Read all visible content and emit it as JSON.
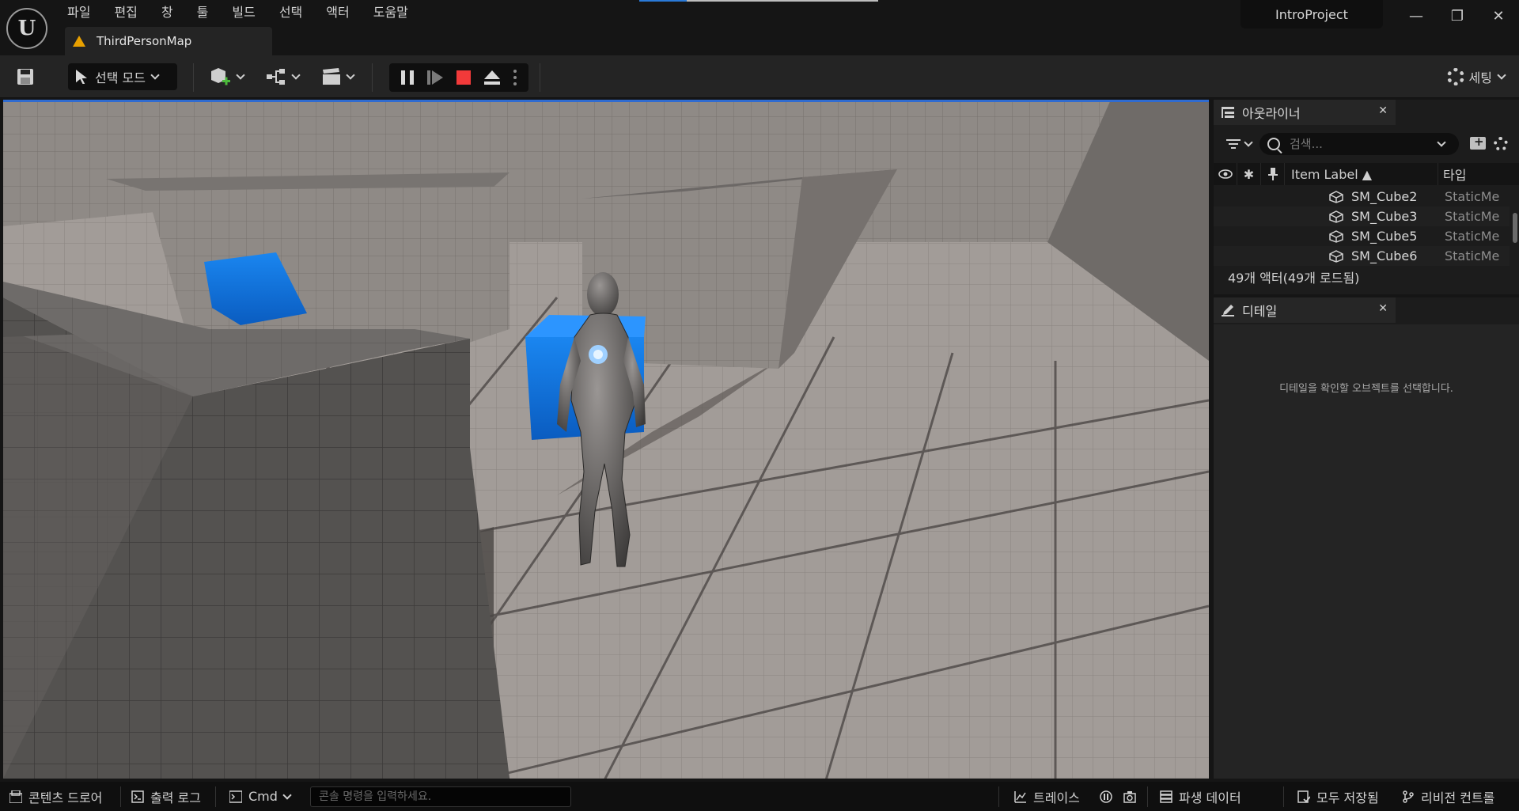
{
  "window": {
    "map_tab": "ThirdPersonMap",
    "project": "IntroProject",
    "minimize": "—",
    "restore": "❐",
    "close": "✕"
  },
  "menu": [
    "파일",
    "편집",
    "창",
    "툴",
    "빌드",
    "선택",
    "액터",
    "도움말"
  ],
  "toolbar": {
    "mode_label": "선택 모드",
    "settings_label": "세팅"
  },
  "outliner": {
    "title": "아웃라이너",
    "search_placeholder": "검색...",
    "columns": {
      "label": "Item Label ▲",
      "type": "타입"
    },
    "rows": [
      {
        "name": "SM_Cube2",
        "type": "StaticMe"
      },
      {
        "name": "SM_Cube3",
        "type": "StaticMe"
      },
      {
        "name": "SM_Cube5",
        "type": "StaticMe"
      },
      {
        "name": "SM_Cube6",
        "type": "StaticMe"
      }
    ],
    "actor_count": "49개 액터(49개 로드됨)"
  },
  "details": {
    "title": "디테일",
    "empty_message": "디테일을 확인할 오브젝트를 선택합니다."
  },
  "statusbar": {
    "content_drawer": "콘텐츠 드로어",
    "output_log": "출력 로그",
    "cmd": "Cmd",
    "console_placeholder": "콘솔 명령을 입력하세요.",
    "trace": "트레이스",
    "derived_data": "파생 데이터",
    "save_all": "모두 저장됨",
    "revision_control": "리비전 컨트롤"
  },
  "colors": {
    "accent_blue": "#2f6bd0",
    "cube_blue": "#1473e6",
    "stop_red": "#f23a3a",
    "warning_orange": "#e8a000"
  }
}
